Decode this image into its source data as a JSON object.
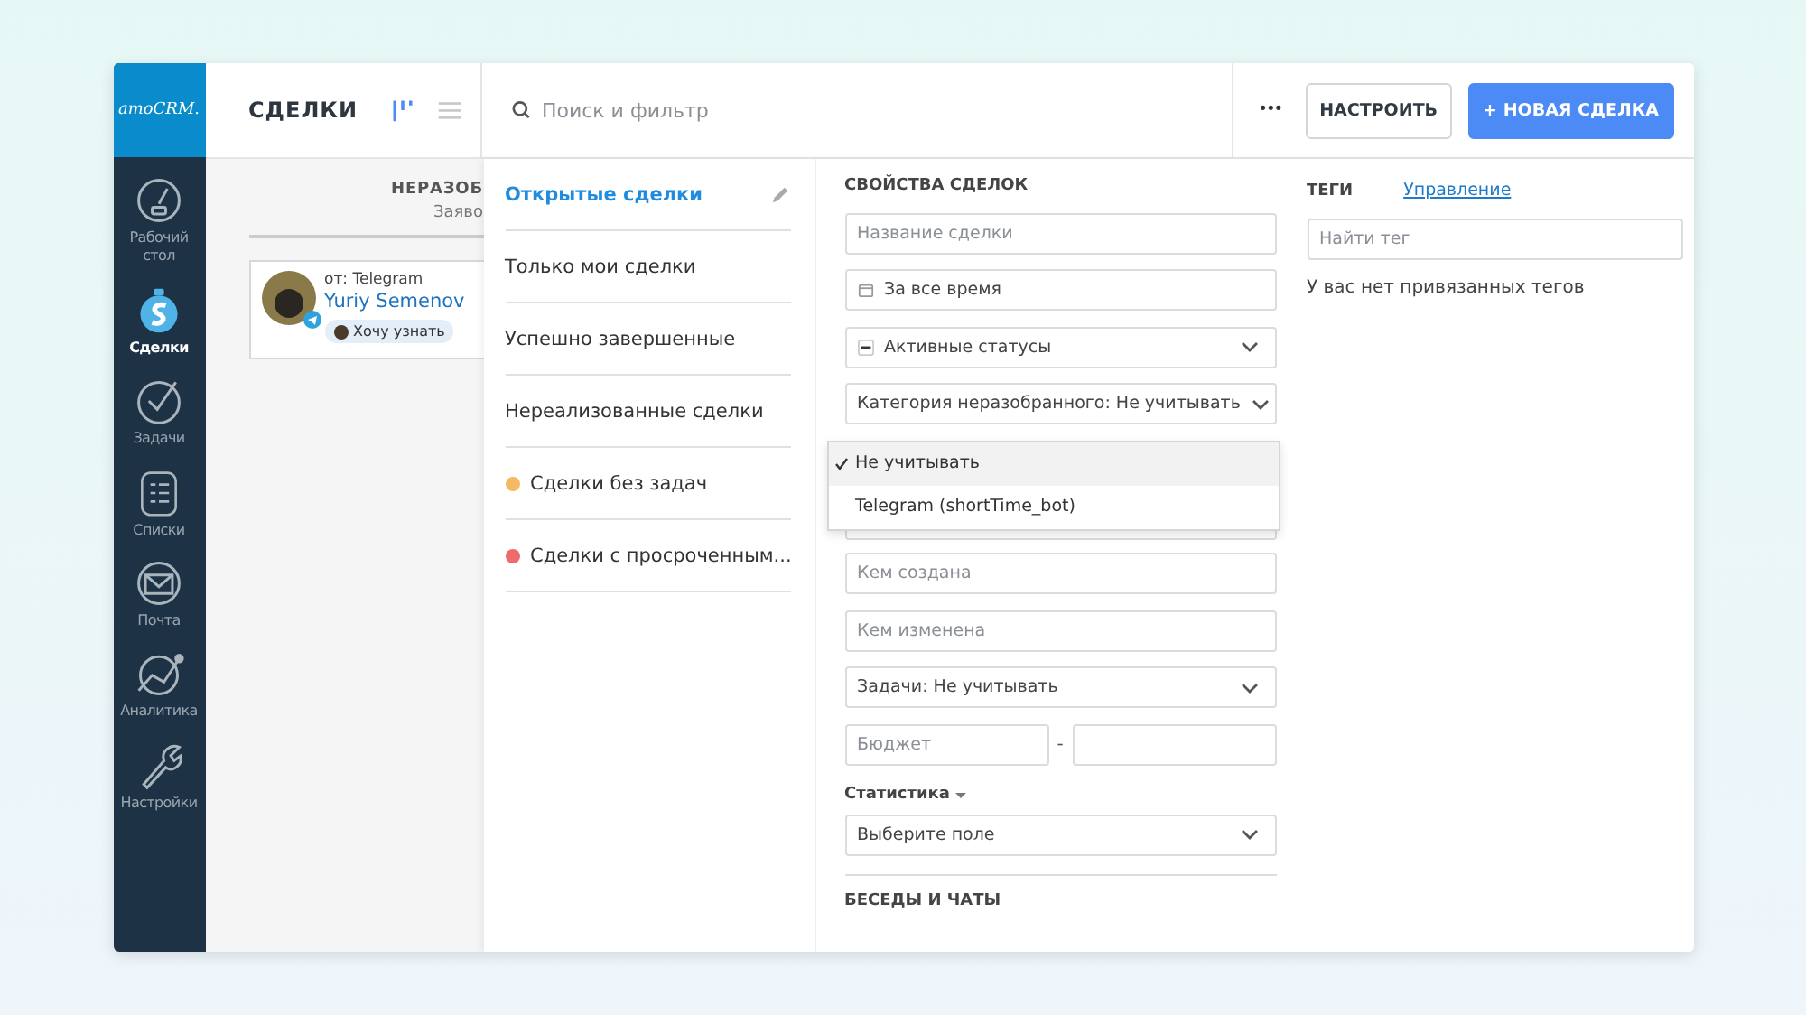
{
  "logo": "amoCRM.",
  "nav": [
    {
      "kind": "dashboard",
      "label": "Рабочий стол",
      "selected": false
    },
    {
      "kind": "deals",
      "label": "Сделки",
      "selected": true
    },
    {
      "kind": "tasks",
      "label": "Задачи",
      "selected": false
    },
    {
      "kind": "lists",
      "label": "Списки",
      "selected": false
    },
    {
      "kind": "mail",
      "label": "Почта",
      "selected": false
    },
    {
      "kind": "analytics",
      "label": "Аналитика",
      "selected": false
    },
    {
      "kind": "settings",
      "label": "Настройки",
      "selected": false
    }
  ],
  "header": {
    "title": "СДЕЛКИ",
    "views": [
      {
        "kind": "pipeline",
        "selected": true
      },
      {
        "kind": "list",
        "selected": false
      }
    ],
    "search": {
      "placeholder": "Поиск и фильтр"
    },
    "more": "•••",
    "buttons": [
      {
        "kind": "secondary",
        "label": "НАСТРОИТЬ"
      },
      {
        "kind": "primary",
        "label": "+ НОВАЯ СДЕЛКА"
      }
    ]
  },
  "column": {
    "title": "НЕРАЗОБ",
    "subtitle": "Заяво",
    "card": {
      "source": "от: Telegram",
      "name": "Yuriy Semenov",
      "tag": "Хочу узнать"
    }
  },
  "presets": [
    {
      "label": "Открытые сделки",
      "selected": true
    },
    {
      "label": "Только мои сделки",
      "selected": false
    },
    {
      "label": "Успешно завершенные",
      "selected": false
    },
    {
      "label": "Нереализованные сделки",
      "selected": false
    },
    {
      "label": "Сделки без задач",
      "selected": false,
      "color": "#f5b963"
    },
    {
      "label": "Сделки с просроченным...",
      "selected": false,
      "color": "#ef6a6a"
    }
  ],
  "properties": {
    "title": "СВОЙСТВА СДЕЛОК",
    "fields_top": [
      {
        "kind": "input",
        "placeholder": "Название сделки"
      },
      {
        "kind": "date",
        "value": "За все время"
      },
      {
        "kind": "status",
        "value": "Активные статусы"
      },
      {
        "kind": "select",
        "value": "Категория неразобранного: Не учитывать"
      }
    ],
    "dropdown": [
      {
        "label": "Не учитывать",
        "selected": true
      },
      {
        "label": "Telegram (shortTime_bot)",
        "selected": false
      }
    ],
    "fields_bottom": [
      {
        "kind": "input",
        "placeholder": "Кем создана"
      },
      {
        "kind": "input",
        "placeholder": "Кем изменена"
      },
      {
        "kind": "select",
        "value": "Задачи: Не учитывать"
      }
    ],
    "budget": {
      "placeholder": "Бюджет",
      "separator": "-"
    },
    "statistics": {
      "label": "Статистика",
      "select": "Выберите поле"
    },
    "next_section": "БЕСЕДЫ И ЧАТЫ"
  },
  "tags": {
    "title": "ТЕГИ",
    "link": "Управление",
    "search": {
      "placeholder": "Найти тег"
    },
    "empty": "У вас нет привязанных тегов"
  }
}
